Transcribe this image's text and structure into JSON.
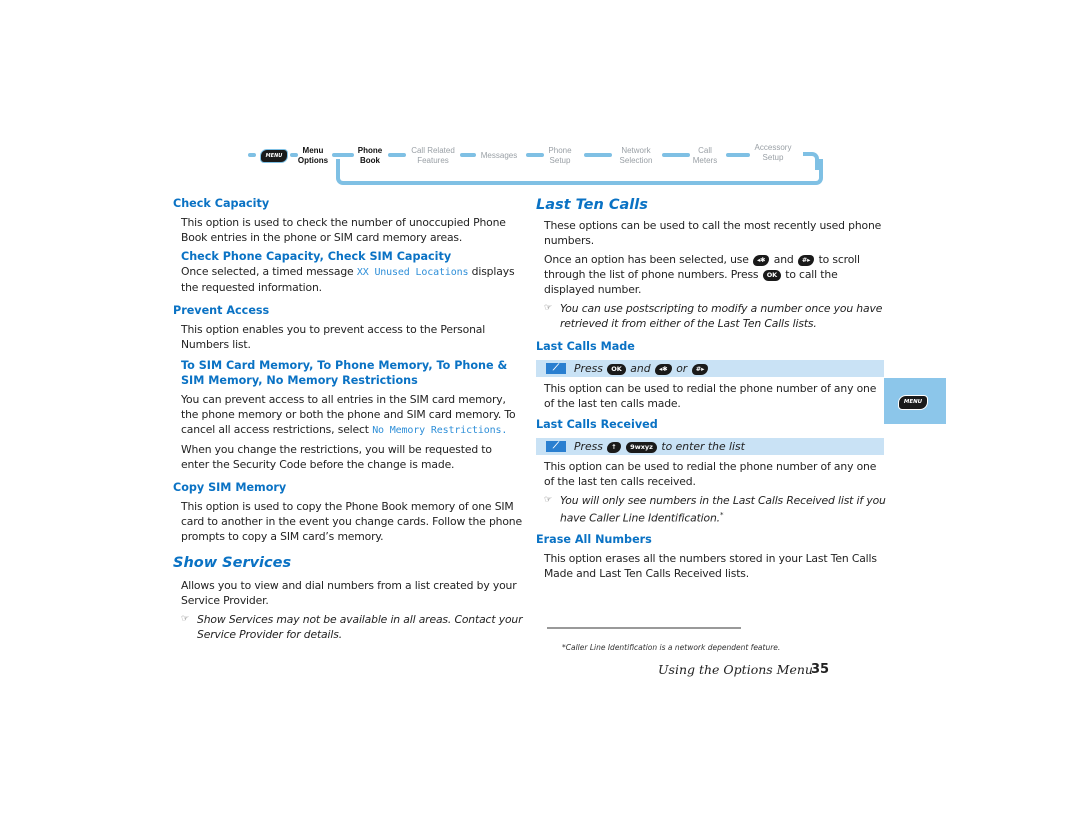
{
  "nav": {
    "menu_key_label": "MENU",
    "items": [
      {
        "line1": "Menu",
        "line2": "Options",
        "active": true
      },
      {
        "line1": "Phone",
        "line2": "Book",
        "active": true
      },
      {
        "line1": "Call Related",
        "line2": "Features",
        "active": false
      },
      {
        "line1": "Messages",
        "line2": "",
        "active": false
      },
      {
        "line1": "Phone",
        "line2": "Setup",
        "active": false
      },
      {
        "line1": "Network",
        "line2": "Selection",
        "active": false
      },
      {
        "line1": "Call",
        "line2": "Meters",
        "active": false
      },
      {
        "line1": "Accessory",
        "line2": "Setup",
        "active": false
      }
    ]
  },
  "left": {
    "check_capacity": {
      "heading": "Check Capacity",
      "body": "This option is used to check the number of unoccupied Phone Book entries in the phone or SIM card memory areas.",
      "sub_heading": "Check Phone Capacity, Check SIM Capacity",
      "sub_body_pre": "Once selected, a timed message ",
      "sub_body_display": "XX Unused Locations",
      "sub_body_post": " displays the requested information."
    },
    "prevent_access": {
      "heading": "Prevent Access",
      "body": "This option enables you to prevent access to the Personal Numbers list.",
      "sub_heading": "To SIM Card Memory, To Phone Memory, To Phone & SIM Memory, No Memory Restrictions",
      "sub_body_pre": "You can prevent access to all entries in the SIM card memory, the phone memory or both the phone and SIM card memory. To cancel all access restrictions, select ",
      "sub_body_display": "No Memory Restrictions.",
      "sub_body2": "When you change the restrictions, you will be requested to enter the Security Code before the change is made."
    },
    "copy_sim": {
      "heading": "Copy SIM Memory",
      "body": "This option is used to copy the Phone Book memory of one SIM card to another in the event you change cards. Follow the phone prompts to copy a SIM card’s memory."
    },
    "show_services": {
      "heading": "Show Services",
      "body": "Allows you to view and dial numbers from a list created by your Service Provider.",
      "note": "Show Services may not be available in all areas. Contact your Service Provider for details."
    }
  },
  "right": {
    "last_ten_calls": {
      "heading": "Last Ten Calls",
      "body1": "These options can be used to call the most recently used phone numbers.",
      "body2_a": "Once an option has been selected, use ",
      "body2_and": " and ",
      "body2_b": " to scroll through the list of phone numbers. Press ",
      "body2_c": " to call the displayed number.",
      "note": "You can use postscripting to modify a number once you have retrieved it from either of the Last Ten Calls lists."
    },
    "last_calls_made": {
      "heading": "Last Calls Made",
      "press": "Press",
      "and": "and",
      "or": "or",
      "body": "This option can be used to redial the phone number of any one of the last ten calls made."
    },
    "last_calls_received": {
      "heading": "Last Calls Received",
      "press": "Press",
      "tail": "to enter the list",
      "body": "This option can be used to redial the phone number of any one of the last ten calls received.",
      "note": "You will only see numbers in the Last Calls Received list if you have Caller Line Identification.",
      "note_mark": "*"
    },
    "erase_all": {
      "heading": "Erase All Numbers",
      "body": "This option erases all the numbers stored in your Last Ten Calls Made and Last Ten Calls Received lists."
    }
  },
  "keys": {
    "left_star": "◂✱",
    "hash_right": "#▸",
    "ok": "OK",
    "up": "↑",
    "nine": "9wxyz",
    "shortcut": "⟋"
  },
  "side_tab": {
    "label": "MENU"
  },
  "footnote": "*Caller Line Identification is a network dependent feature.",
  "footer": {
    "title": "Using the Options Menu",
    "page": "35"
  }
}
